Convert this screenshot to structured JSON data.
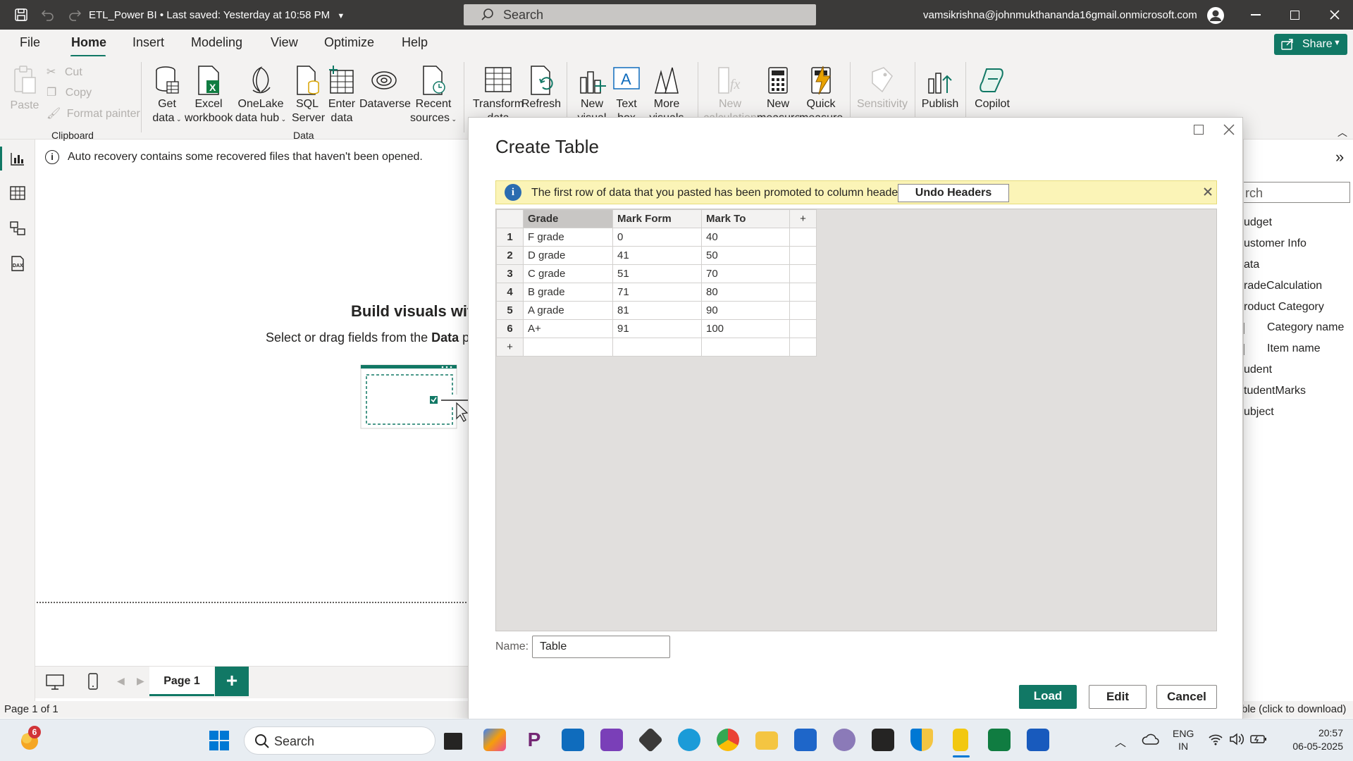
{
  "titlebar": {
    "file_title": "ETL_Power BI",
    "save_status": "Last saved: Yesterday at 10:58 PM",
    "search_placeholder": "Search",
    "account": "vamsikrishna@johnmukthananda16gmail.onmicrosoft.com"
  },
  "menu": {
    "items": [
      "File",
      "Home",
      "Insert",
      "Modeling",
      "View",
      "Optimize",
      "Help"
    ],
    "share_label": "Share"
  },
  "ribbon": {
    "clipboard": {
      "paste": "Paste",
      "cut": "Cut",
      "copy": "Copy",
      "format_painter": "Format painter",
      "group": "Clipboard"
    },
    "data": {
      "get_data": [
        "Get",
        "data"
      ],
      "excel": [
        "Excel",
        "workbook"
      ],
      "onelake": [
        "OneLake",
        "data hub"
      ],
      "sql": [
        "SQL",
        "Server"
      ],
      "enter": [
        "Enter",
        "data"
      ],
      "dataverse": "Dataverse",
      "recent": [
        "Recent",
        "sources"
      ],
      "group": "Data"
    },
    "queries": {
      "transform": [
        "Transform",
        "data"
      ],
      "refresh": "Refresh"
    },
    "insert": {
      "new_visual": [
        "New",
        "visual"
      ],
      "text_box": [
        "Text",
        "box"
      ],
      "more_visuals": [
        "More",
        "visuals"
      ]
    },
    "calc": {
      "new_calc": [
        "New",
        "calculation"
      ],
      "new_measure": [
        "New",
        "measure"
      ],
      "quick_measure": [
        "Quick",
        "measure"
      ]
    },
    "sensitivity": "Sensitivity",
    "publish": "Publish",
    "copilot": "Copilot"
  },
  "infobar": {
    "text": "Auto recovery contains some recovered files that haven't been opened."
  },
  "canvas": {
    "heading": "Build visuals with",
    "sub_prefix": "Select or drag fields from the",
    "sub_bold": "Data",
    "sub_suffix": "p"
  },
  "dialog": {
    "title": "Create Table",
    "notice": "The first row of data that you pasted has been promoted to column headers.",
    "undo_label": "Undo Headers",
    "columns": [
      "Grade",
      "Mark Form",
      "Mark To"
    ],
    "add_col": "+",
    "add_row": "+",
    "rows": [
      {
        "n": "1",
        "c": [
          "F grade",
          "0",
          "40"
        ]
      },
      {
        "n": "2",
        "c": [
          "D grade",
          "41",
          "50"
        ]
      },
      {
        "n": "3",
        "c": [
          "C grade",
          "51",
          "70"
        ]
      },
      {
        "n": "4",
        "c": [
          "B grade",
          "71",
          "80"
        ]
      },
      {
        "n": "5",
        "c": [
          "A grade",
          "81",
          "90"
        ]
      },
      {
        "n": "6",
        "c": [
          "A+",
          "91",
          "100"
        ]
      }
    ],
    "name_label": "Name:",
    "name_value": "Table",
    "load": "Load",
    "edit": "Edit",
    "cancel": "Cancel"
  },
  "data_pane": {
    "search_partial": "rch",
    "items": [
      "udget",
      "ustomer Info",
      "ata",
      "radeCalculation",
      "roduct Category",
      "Category name",
      "Item name",
      "udent",
      "tudentMarks",
      "ubject"
    ]
  },
  "pages": {
    "tab": "Page 1"
  },
  "status": {
    "left": "Page 1 of 1",
    "right": "ble (click to download)"
  },
  "taskbar": {
    "badge": "6",
    "search": "Search",
    "lang1": "ENG",
    "lang2": "IN",
    "time": "20:57",
    "date": "06-05-2025"
  },
  "colors": {
    "accent": "#117865",
    "notice_bg": "#fbf4b7",
    "titlebar": "#3b3a39"
  }
}
